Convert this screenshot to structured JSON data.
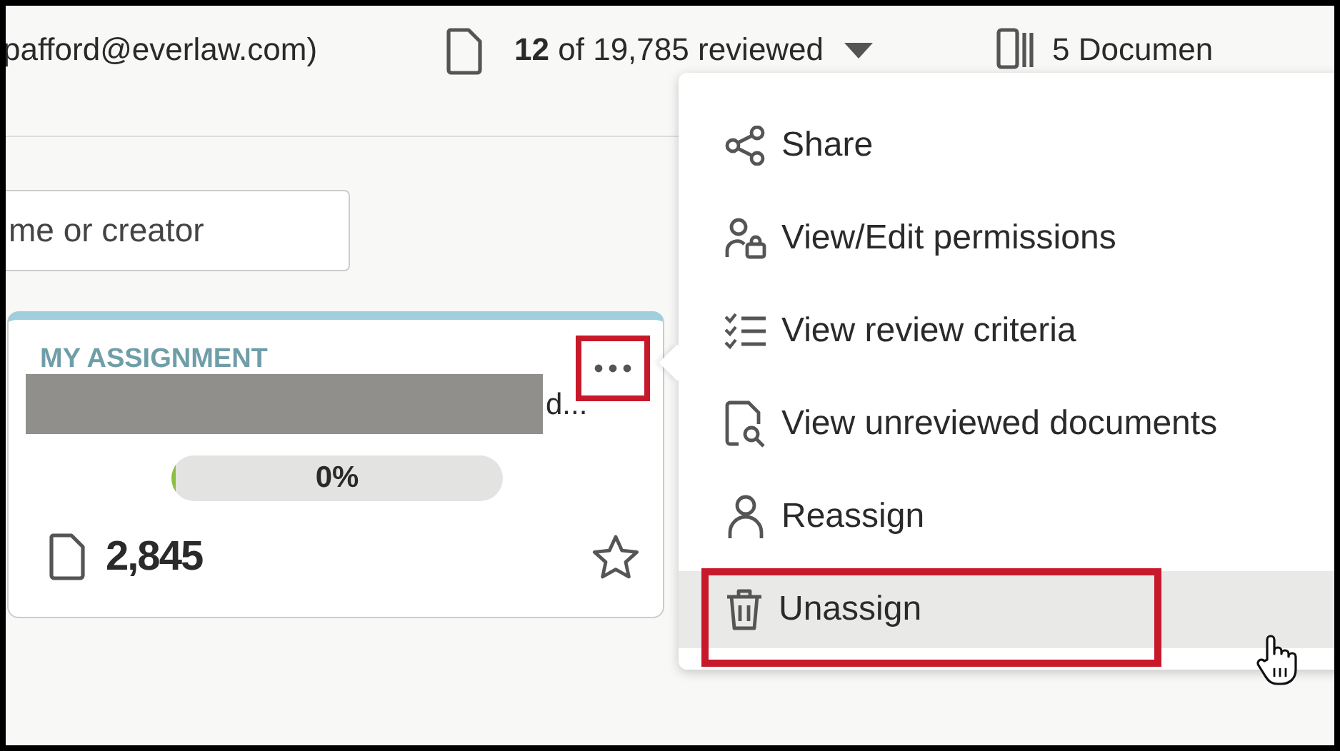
{
  "header": {
    "user": "pafford@everlaw.com)",
    "progress": "**12** of 19,785 reviewed",
    "documents": "5 Documen"
  },
  "search": {
    "placeholder": "me or creator"
  },
  "card": {
    "label": "MY ASSIGNMENT",
    "title": "d...",
    "title_redacted": true,
    "more_button_annotated": true,
    "progress": {
      "level": 0,
      "reading": "0%"
    },
    "count": "2,845",
    "starred": false
  },
  "menu": {
    "items": [
      {
        "kind": "share",
        "label": "Share",
        "selected": false,
        "annotated": false
      },
      {
        "kind": "permissions",
        "label": "View/Edit permissions",
        "selected": false,
        "annotated": false
      },
      {
        "kind": "criteria",
        "label": "View review criteria",
        "selected": false,
        "annotated": false
      },
      {
        "kind": "unreviewed",
        "label": "View unreviewed documents",
        "selected": false,
        "annotated": false
      },
      {
        "kind": "reassign",
        "label": "Reassign",
        "selected": false,
        "annotated": false
      },
      {
        "kind": "unassign",
        "label": "Unassign",
        "selected": true,
        "annotated": true
      }
    ]
  }
}
